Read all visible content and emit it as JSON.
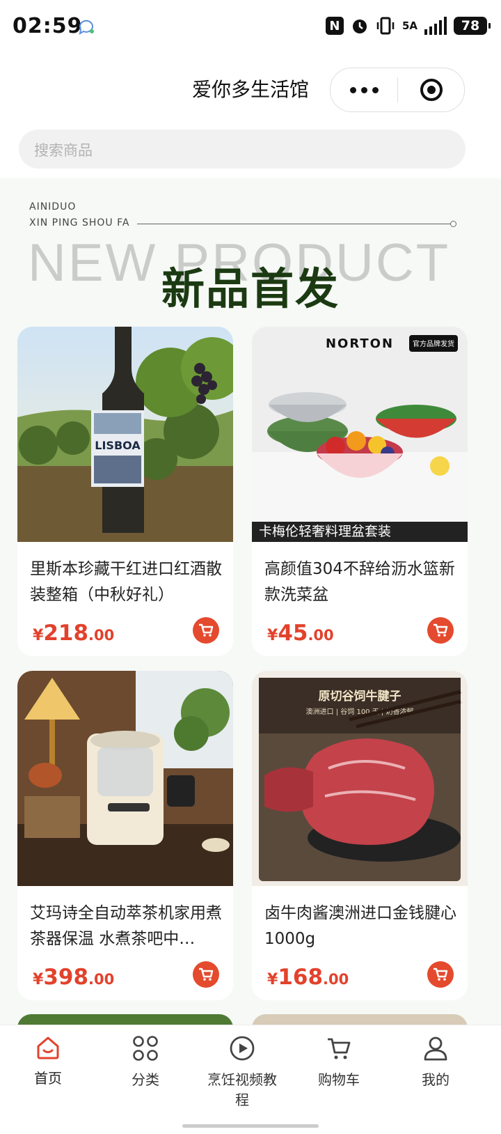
{
  "status_bar": {
    "time": "02:59",
    "network": "5A",
    "battery": "78"
  },
  "header": {
    "title": "爱你多生活馆"
  },
  "search": {
    "placeholder": "搜索商品"
  },
  "banner": {
    "brand": "AINIDUO",
    "subtitle": "XIN PING SHOU FA",
    "ghost_text": "NEW PRODUCT",
    "headline": "新品首发"
  },
  "products": [
    {
      "name": "里斯本珍藏干红进口红酒散装整箱（中秋好礼）",
      "currency": "¥",
      "price_int": "218",
      "price_dec": ".00",
      "image_text": "LISBOA"
    },
    {
      "name": "高颜值304不辞给沥水篮新款洗菜盆",
      "currency": "¥",
      "price_int": "45",
      "price_dec": ".00",
      "image_brand": "NORTON",
      "image_badge": "官方品牌发货",
      "image_caption": "卡梅伦轻奢料理盆套装"
    },
    {
      "name": "艾玛诗全自动萃茶机家用煮茶器保温 水煮茶吧中…",
      "currency": "¥",
      "price_int": "398",
      "price_dec": ".00"
    },
    {
      "name": "卤牛肉酱澳洲进口金钱腱心1000g",
      "currency": "¥",
      "price_int": "168",
      "price_dec": ".00",
      "image_title": "原切谷饲牛腱子",
      "image_sub": "澳洲进口 | 谷饲 100 天 | 奶香浓郁"
    }
  ],
  "tabbar": {
    "items": [
      {
        "label": "首页",
        "icon": "home-icon"
      },
      {
        "label": "分类",
        "icon": "grid-icon"
      },
      {
        "label": "烹饪视频教程",
        "icon": "play-icon"
      },
      {
        "label": "购物车",
        "icon": "cart-icon"
      },
      {
        "label": "我的",
        "icon": "user-icon"
      }
    ]
  },
  "colors": {
    "accent": "#e2422c",
    "headline": "#1b3a12",
    "content_bg": "#f6f9f5"
  }
}
